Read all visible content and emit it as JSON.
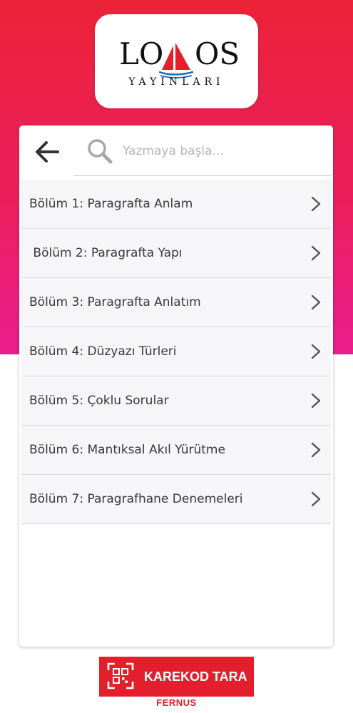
{
  "colors": {
    "header_gradient_top": "#ec2238",
    "header_gradient_bottom": "#e91e8c",
    "accent_red": "#e31e2d",
    "list_background": "#f6f5f8"
  },
  "logo": {
    "name": "LODOS",
    "tagline": "YAYINLARI"
  },
  "header": {
    "back_icon": "arrow-left-icon"
  },
  "search": {
    "icon": "search-icon",
    "placeholder": "Yazmaya başla..."
  },
  "chapters": [
    {
      "label": "Bölüm 1: Paragrafta Anlam"
    },
    {
      "label": " Bölüm 2: Paragrafta Yapı"
    },
    {
      "label": "Bölüm 3: Paragrafta Anlatım"
    },
    {
      "label": "Bölüm 4: Düzyazı Türleri"
    },
    {
      "label": "Bölüm 5: Çoklu Sorular"
    },
    {
      "label": "Bölüm 6: Mantıksal Akıl Yürütme"
    },
    {
      "label": "Bölüm 7: Paragrafhane Denemeleri"
    }
  ],
  "qr_button": {
    "label": "KAREKOD TARA",
    "icon": "qr-scan-icon"
  },
  "brand": {
    "label": "FERNUS"
  }
}
